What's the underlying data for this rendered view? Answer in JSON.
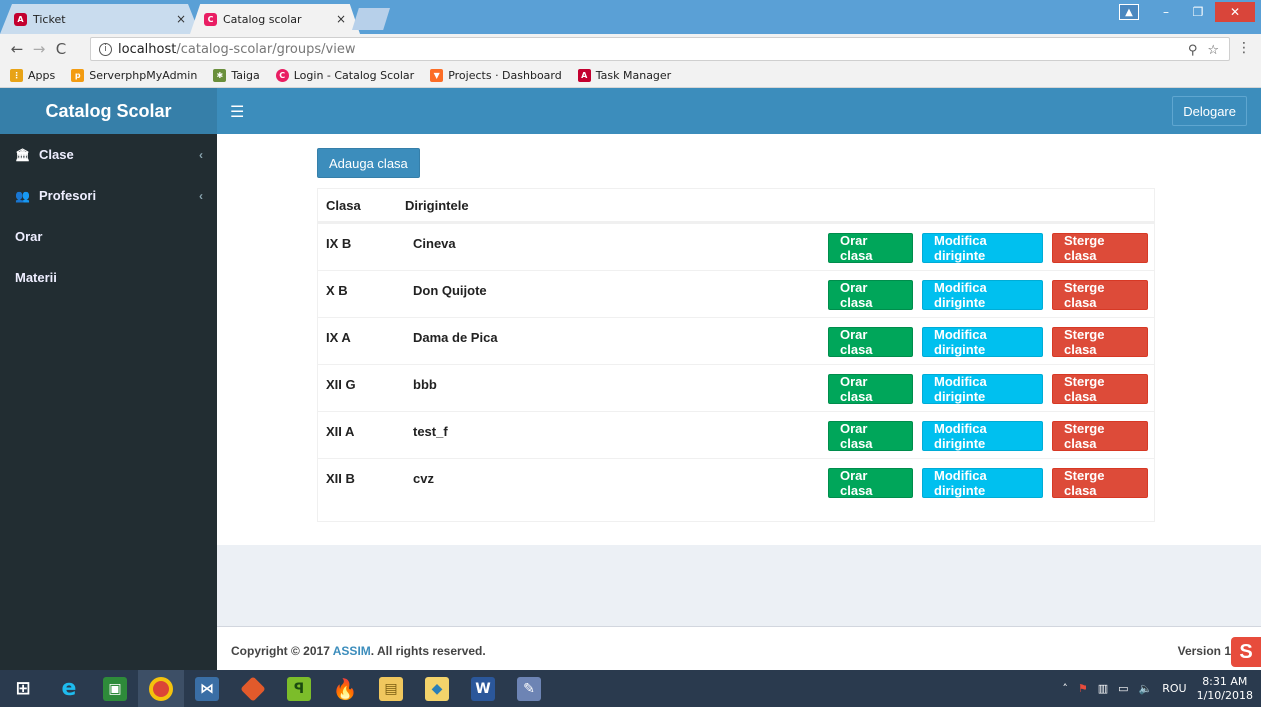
{
  "browser": {
    "tabs": [
      {
        "title": "Ticket",
        "favicon_color": "#c3002f",
        "favicon_letter": "A"
      },
      {
        "title": "Catalog scolar",
        "favicon_color": "#e91e63",
        "favicon_letter": "C"
      }
    ],
    "url_host": "localhost",
    "url_path": "/catalog-scolar/groups/view",
    "bookmarks": [
      {
        "label": "Apps",
        "icon": "apps-grid-icon",
        "color": "#e8a317"
      },
      {
        "label": "ServerphpMyAdmin",
        "icon": "phpmyadmin-icon",
        "color": "#f39c12"
      },
      {
        "label": "Taiga",
        "icon": "taiga-icon",
        "color": "#6a8f3c"
      },
      {
        "label": "Login - Catalog Scolar",
        "icon": "catalog-icon",
        "color": "#e91e63"
      },
      {
        "label": "Projects · Dashboard",
        "icon": "gitlab-icon",
        "color": "#fc6d26"
      },
      {
        "label": "Task Manager",
        "icon": "angular-icon",
        "color": "#c3002f"
      }
    ]
  },
  "header": {
    "logo": "Catalog Scolar",
    "logout_label": "Delogare",
    "accent": "#3c8dbc"
  },
  "sidebar": {
    "items": [
      {
        "label": "Clase",
        "icon": "institution-icon",
        "has_children": true
      },
      {
        "label": "Profesori",
        "icon": "users-icon",
        "has_children": true
      },
      {
        "label": "Orar",
        "icon": "",
        "has_children": false
      },
      {
        "label": "Materii",
        "icon": "",
        "has_children": false
      }
    ]
  },
  "main": {
    "add_button": "Adauga clasa",
    "table": {
      "columns": [
        "Clasa",
        "Dirigintele"
      ],
      "action_labels": {
        "schedule": "Orar clasa",
        "edit": "Modifica diriginte",
        "delete": "Sterge clasa"
      },
      "rows": [
        {
          "clasa": "IX B",
          "diriginte": "Cineva"
        },
        {
          "clasa": "X B",
          "diriginte": "Don Quijote"
        },
        {
          "clasa": "IX A",
          "diriginte": "Dama de Pica"
        },
        {
          "clasa": "XII G",
          "diriginte": "bbb"
        },
        {
          "clasa": "XII A",
          "diriginte": "test_f"
        },
        {
          "clasa": "XII B",
          "diriginte": "cvz"
        }
      ]
    }
  },
  "footer": {
    "copyright_prefix": "Copyright © 2017",
    "brand": "ASSIM",
    "copyright_suffix": ". All rights reserved.",
    "version": "Version 1"
  },
  "taskbar": {
    "language": "ROU",
    "time": "8:31 AM",
    "date": "1/10/2018"
  }
}
